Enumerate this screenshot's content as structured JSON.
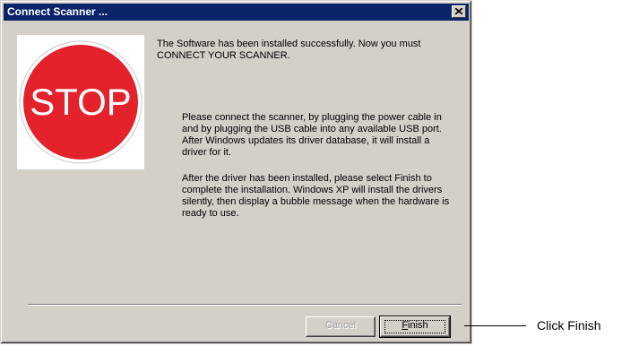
{
  "window": {
    "title": "Connect Scanner ...",
    "close_icon": "close-icon"
  },
  "image": {
    "text": "STOP",
    "colors": {
      "sign": "#e3222b",
      "ring": "#ffffff"
    }
  },
  "content": {
    "intro": "The Software has been installed successfully.  Now you must CONNECT YOUR SCANNER.",
    "para1": "Please connect the scanner, by plugging the power cable in and by plugging the USB cable into any available USB port. After Windows updates its driver database, it will install a driver for it.",
    "para2": "After the driver has been installed, please select Finish to complete the installation.  Windows XP will install the drivers silently, then display a bubble message when the hardware is ready to use."
  },
  "buttons": {
    "cancel": "Cancel",
    "finish_accel": "F",
    "finish_rest": "inish"
  },
  "annotation": {
    "label": "Click Finish"
  },
  "colors": {
    "titlebar": "#0a246a",
    "dialog": "#d4d0c8"
  }
}
